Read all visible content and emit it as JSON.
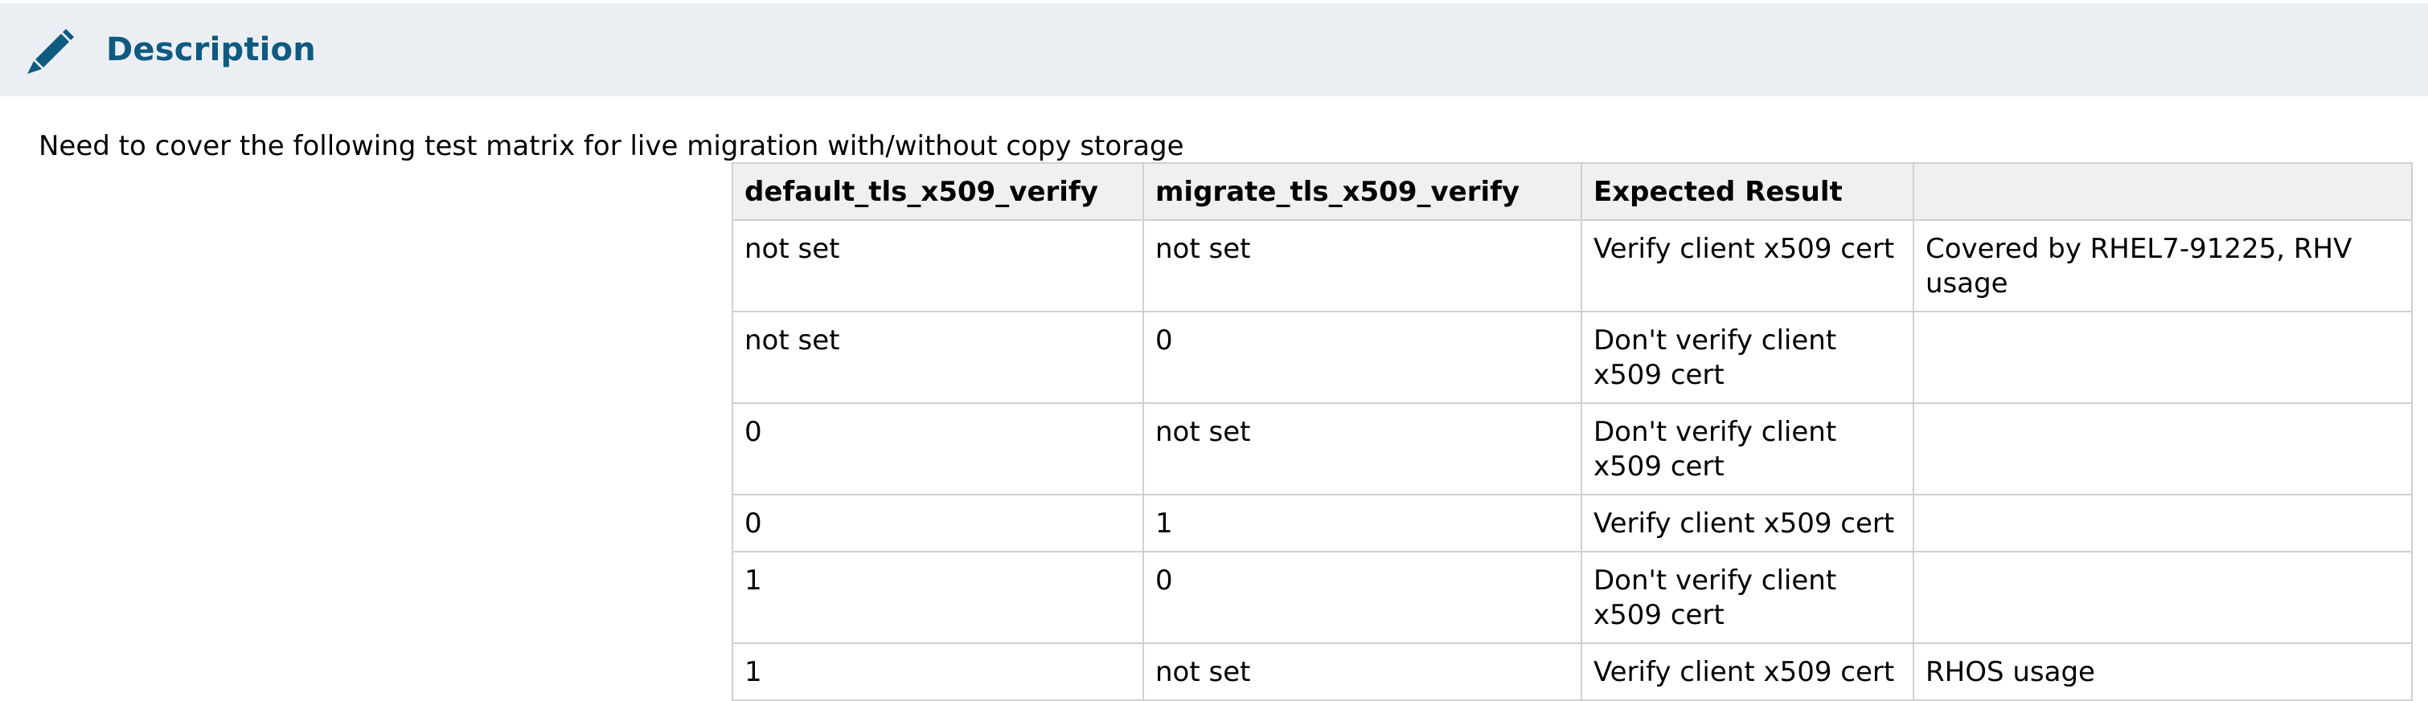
{
  "header": {
    "icon": "pencil-icon",
    "title": "Description",
    "title_color": "#0f5a80",
    "background": "#ebeff4"
  },
  "intro_text": "Need to cover the following test matrix for live migration with/without copy storage",
  "table": {
    "columns": [
      "default_tls_x509_verify",
      "migrate_tls_x509_verify",
      "Expected Result",
      ""
    ],
    "rows": [
      [
        "not set",
        "not set",
        "Verify client x509 cert",
        "Covered by RHEL7-91225, RHV usage"
      ],
      [
        "not set",
        "0",
        "Don't verify client x509 cert",
        ""
      ],
      [
        "0",
        "not set",
        "Don't verify client x509 cert",
        ""
      ],
      [
        "0",
        "1",
        "Verify client x509 cert",
        ""
      ],
      [
        "1",
        "0",
        "Don't verify client x509 cert",
        ""
      ],
      [
        "1",
        "not set",
        "Verify client x509 cert",
        "RHOS usage"
      ]
    ]
  }
}
